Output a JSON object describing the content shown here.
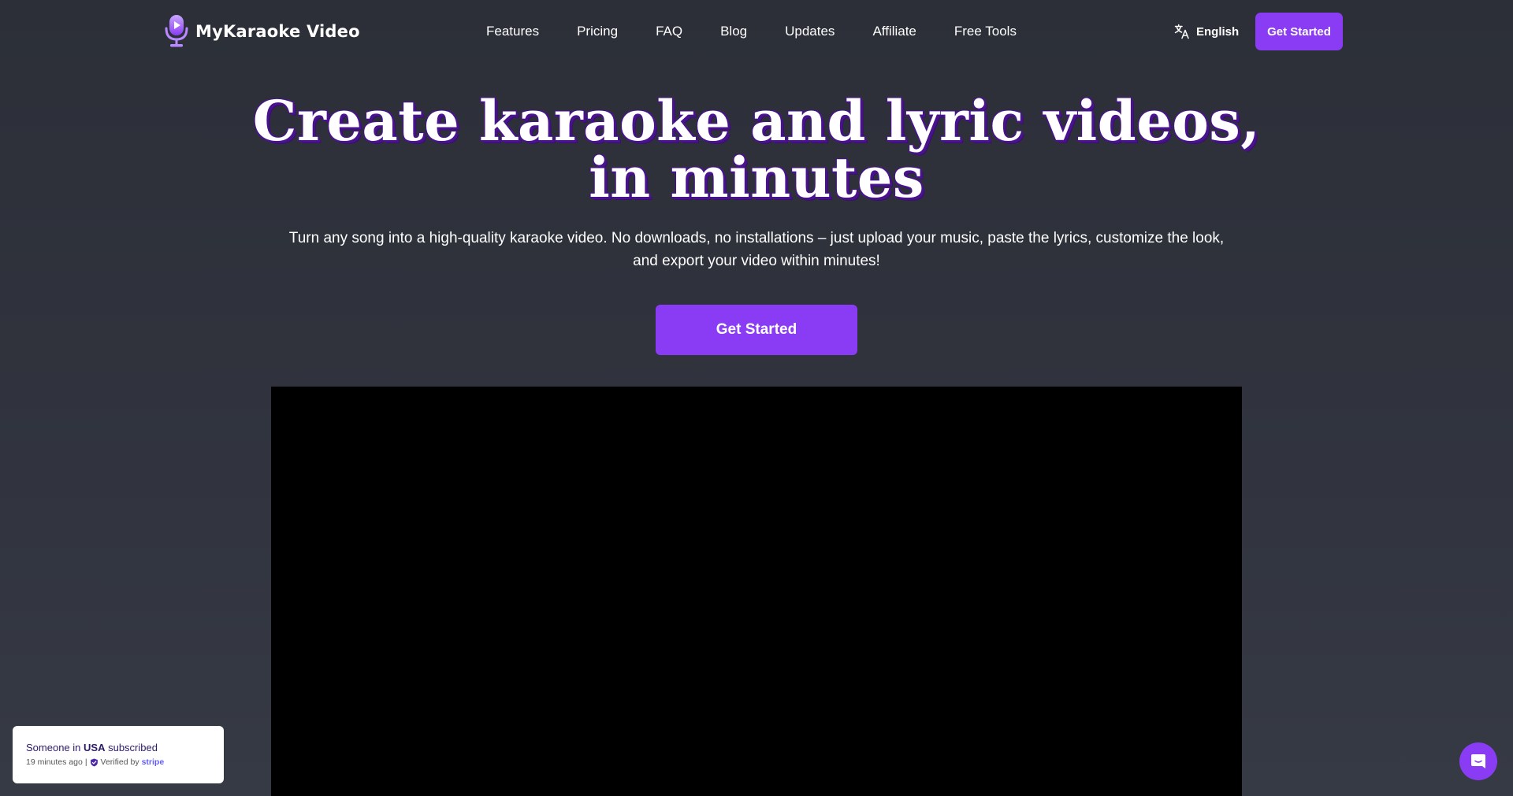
{
  "brand": {
    "name": "MyKaraoke Video",
    "accent_color": "#8a3cf5",
    "logo_icon": "microphone-play-icon"
  },
  "nav": {
    "items": [
      "Features",
      "Pricing",
      "FAQ",
      "Blog",
      "Updates",
      "Affiliate",
      "Free Tools"
    ]
  },
  "language": {
    "icon": "translate-icon",
    "label": "English"
  },
  "header_cta": {
    "label": "Get Started"
  },
  "hero": {
    "title_line1": "Create karaoke and lyric videos,",
    "title_line2": "in minutes",
    "subtitle_line1": "Turn any song into a high-quality karaoke video. No downloads, no installations – just upload your music, paste the lyrics, customize the look,",
    "subtitle_line2": "and export your video within minutes!",
    "cta_label": "Get Started"
  },
  "notification": {
    "prefix": "Someone in",
    "location": "USA",
    "suffix": "subscribed",
    "time": "19 minutes ago",
    "separator": "|",
    "verified_label": "Verified by",
    "verified_brand": "stripe",
    "icon": "shield-check-icon"
  },
  "chat": {
    "icon": "chat-icon"
  }
}
